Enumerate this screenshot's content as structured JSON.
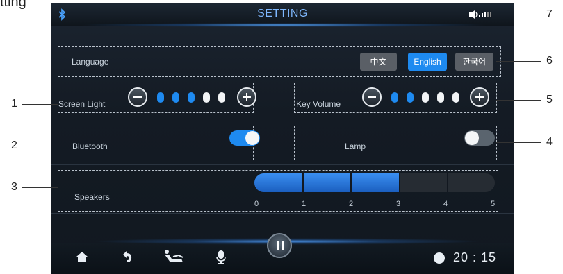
{
  "doc_title": "tting",
  "header": {
    "title": "SETTING"
  },
  "language": {
    "label": "Language",
    "options": [
      {
        "label": "中文",
        "selected": false
      },
      {
        "label": "English",
        "selected": true
      },
      {
        "label": "한국어",
        "selected": false
      }
    ]
  },
  "screen_light": {
    "label": "Screen Light",
    "level": 3,
    "max": 5
  },
  "key_volume": {
    "label": "Key Volume",
    "level": 2,
    "max": 5
  },
  "bluetooth": {
    "label": "Bluetooth",
    "enabled": true
  },
  "lamp": {
    "label": "Lamp",
    "enabled": false
  },
  "speakers": {
    "label": "Speakers",
    "value": 3,
    "ticks": [
      "0",
      "1",
      "2",
      "3",
      "4",
      "5"
    ]
  },
  "status": {
    "time": "20 : 15"
  },
  "callouts": [
    "1",
    "2",
    "3",
    "4",
    "5",
    "6",
    "7"
  ],
  "colors": {
    "accent": "#1e8af0",
    "pip_on": "#1e8af0",
    "pip_off": "#f2f4f6",
    "toggle_on": "#1e8af0",
    "toggle_off": "#5a646e"
  },
  "icons": [
    "bluetooth-icon",
    "volume-signal-icon",
    "home-icon",
    "back-icon",
    "massage-chair-icon",
    "microphone-icon",
    "pause-icon",
    "clock-icon",
    "minus-icon",
    "plus-icon"
  ]
}
